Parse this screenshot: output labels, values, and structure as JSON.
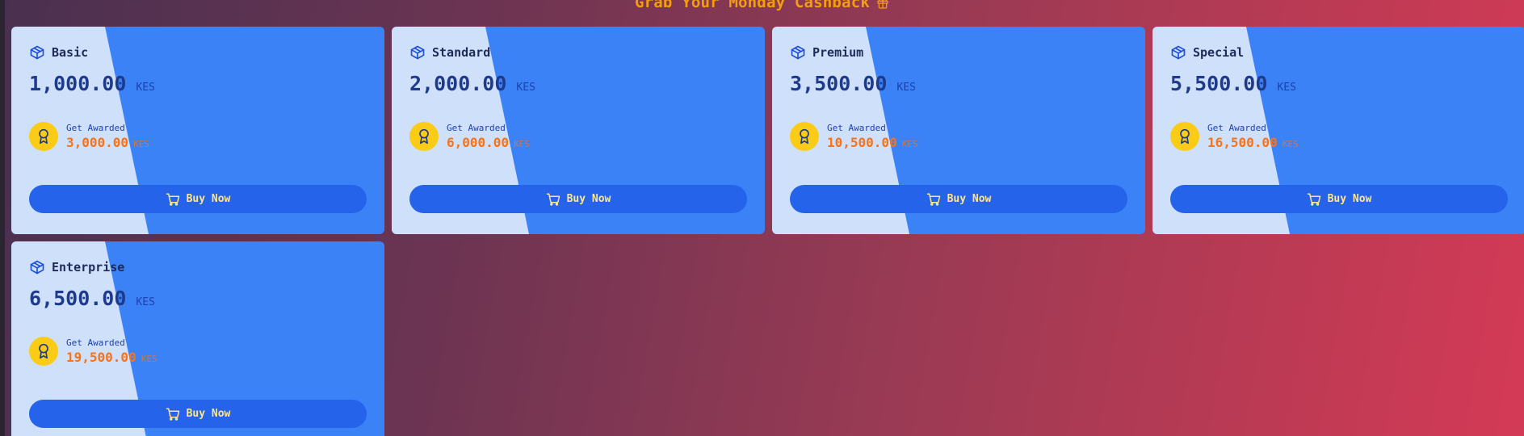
{
  "header": {
    "title": "Grab Your Monday Cashback",
    "icon": "gift-icon"
  },
  "colors": {
    "card_blue": "#3b82f6",
    "card_light": "#cfe0fb",
    "button": "#2563eb",
    "award_badge": "#facc15",
    "award_amount": "#f97316",
    "header_text": "#f59e0b"
  },
  "plans": [
    {
      "name": "Basic",
      "price": "1,000.00",
      "currency": "KES",
      "award_label": "Get Awarded",
      "award_amount": "3,000.00",
      "award_currency": "KES",
      "button_label": "Buy Now",
      "icon": "box-icon",
      "award_icon": "award-icon",
      "button_icon": "cart-icon"
    },
    {
      "name": "Standard",
      "price": "2,000.00",
      "currency": "KES",
      "award_label": "Get Awarded",
      "award_amount": "6,000.00",
      "award_currency": "KES",
      "button_label": "Buy Now",
      "icon": "box-icon",
      "award_icon": "award-icon",
      "button_icon": "cart-icon"
    },
    {
      "name": "Premium",
      "price": "3,500.00",
      "currency": "KES",
      "award_label": "Get Awarded",
      "award_amount": "10,500.00",
      "award_currency": "KES",
      "button_label": "Buy Now",
      "icon": "box-icon",
      "award_icon": "award-icon",
      "button_icon": "cart-icon"
    },
    {
      "name": "Special",
      "price": "5,500.00",
      "currency": "KES",
      "award_label": "Get Awarded",
      "award_amount": "16,500.00",
      "award_currency": "KES",
      "button_label": "Buy Now",
      "icon": "box-icon",
      "award_icon": "award-icon",
      "button_icon": "cart-icon"
    },
    {
      "name": "Enterprise",
      "price": "6,500.00",
      "currency": "KES",
      "award_label": "Get Awarded",
      "award_amount": "19,500.00",
      "award_currency": "KES",
      "button_label": "Buy Now",
      "icon": "box-icon",
      "award_icon": "award-icon",
      "button_icon": "cart-icon"
    }
  ]
}
